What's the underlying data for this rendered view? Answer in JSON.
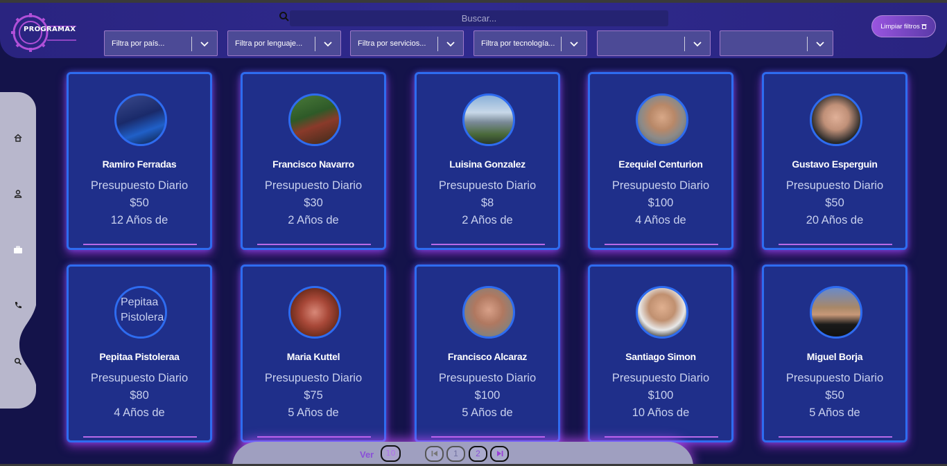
{
  "app": {
    "logo_text": "PROGRAMAX"
  },
  "header": {
    "search_placeholder": "Buscar...",
    "clear_filters_label": "Limpiar filtros",
    "filters": [
      {
        "label": "Filtra por país..."
      },
      {
        "label": "Filtra por lenguaje..."
      },
      {
        "label": "Filtra por servicios..."
      },
      {
        "label": "Filtra por tecnología..."
      },
      {
        "label": ""
      },
      {
        "label": ""
      }
    ]
  },
  "sidebar": {
    "items": [
      {
        "icon": "home-icon"
      },
      {
        "icon": "user-icon"
      },
      {
        "icon": "briefcase-icon"
      },
      {
        "icon": "phone-icon"
      },
      {
        "icon": "search-icon"
      }
    ]
  },
  "colors": {
    "background": "#14134a",
    "header": "#2f2a8e",
    "card": "#1f2f8a",
    "card_border": "#2e6cf0",
    "accent": "#b86ae8"
  },
  "cards": [
    {
      "name": "Ramiro Ferradas",
      "budget_label": "Presupuesto Diario",
      "budget": "$50",
      "experience": "12 Años de"
    },
    {
      "name": "Francisco Navarro",
      "budget_label": "Presupuesto Diario",
      "budget": "$30",
      "experience": "2 Años de"
    },
    {
      "name": "Luisina Gonzalez",
      "budget_label": "Presupuesto Diario",
      "budget": "$8",
      "experience": "2 Años de"
    },
    {
      "name": "Ezequiel Centurion",
      "budget_label": "Presupuesto Diario",
      "budget": "$100",
      "experience": "4 Años de"
    },
    {
      "name": "Gustavo Esperguin",
      "budget_label": "Presupuesto Diario",
      "budget": "$50",
      "experience": "20 Años de"
    },
    {
      "name": "Pepitaa Pistoleraa",
      "budget_label": "Presupuesto Diario",
      "budget": "$80",
      "experience": "4 Años de",
      "avatar_alt": "Pepitaa Pistolera"
    },
    {
      "name": "Maria Kuttel",
      "budget_label": "Presupuesto Diario",
      "budget": "$75",
      "experience": "5 Años de"
    },
    {
      "name": "Francisco Alcaraz",
      "budget_label": "Presupuesto Diario",
      "budget": "$100",
      "experience": "5 Años de"
    },
    {
      "name": "Santiago Simon",
      "budget_label": "Presupuesto Diario",
      "budget": "$100",
      "experience": "10 Años de"
    },
    {
      "name": "Miguel Borja",
      "budget_label": "Presupuesto Diario",
      "budget": "$50",
      "experience": "5 Años de"
    }
  ],
  "pagination": {
    "ver_label": "Ver",
    "per_page": "10",
    "first_icon": "first-page-icon",
    "pages": [
      "1",
      "2"
    ],
    "current_page": "2",
    "last_icon": "last-page-icon"
  }
}
